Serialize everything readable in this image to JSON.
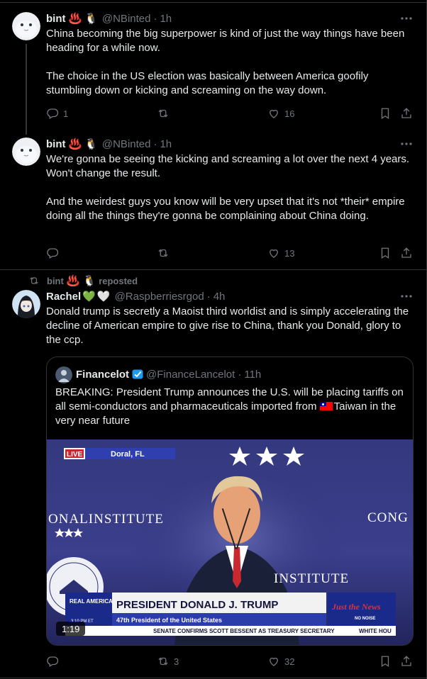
{
  "colors": {
    "background": "#000000",
    "text": "#e7e9ea",
    "muted": "#71767b",
    "border": "#2f3336",
    "verified": "#1d9bf0"
  },
  "posts": [
    {
      "name": "bint",
      "emojis": [
        "♨️",
        "🐧"
      ],
      "handle": "@NBinted",
      "dot": "·",
      "time": "1h",
      "text": "China becoming the big superpower is kind of just the way things have been heading for a while now.\n\nThe choice in the US election was basically between America goofily stumbling down or kicking and screaming on the way down.",
      "actions": {
        "reply": "1",
        "repost": "",
        "like": "16"
      }
    },
    {
      "name": "bint",
      "emojis": [
        "♨️",
        "🐧"
      ],
      "handle": "@NBinted",
      "dot": "·",
      "time": "1h",
      "text": "We're gonna be seeing the kicking and screaming a lot over the next 4 years. Won't change the result.\n\nAnd the weirdest guys you know will be very upset that it's not *their* empire doing all the things they're gonna be complaining about China doing.",
      "actions": {
        "reply": "",
        "repost": "",
        "like": "13"
      }
    },
    {
      "repost_by": "bint",
      "repost_emojis": [
        "♨️",
        "🐧"
      ],
      "repost_label": "reposted",
      "name": "Rachel",
      "emojis": [
        "💚",
        "🤍"
      ],
      "handle": "@Raspberriesrgod",
      "dot": "·",
      "time": "4h",
      "text": "Donald trump is secretly a Maoist third worldist and is simply accelerating the decline of American empire to give rise to China, thank you Donald, glory to the ccp.",
      "actions": {
        "reply": "",
        "repost": "3",
        "like": "32"
      },
      "quote": {
        "name": "Financelot",
        "handle": "@FinanceLancelot",
        "dot": "·",
        "time": "11h",
        "text_before_flag": "BREAKING: President Trump announces the U.S. will be placing tariffs on all semi-conductors and pharmaceuticals imported from ",
        "text_after_flag": "Taiwan in the very near future",
        "video": {
          "duration": "1:19",
          "live_badge": "LIVE",
          "location": "Doral, FL",
          "backdrop_left": "ONALINSTITUTE",
          "backdrop_right": "CONG",
          "backdrop_lower": "INSTITUTE",
          "network_logo": "REAL AMERICA'S VOICE",
          "network_time": "3:10 PM ET",
          "banner_title": "PRESIDENT DONALD J. TRUMP",
          "banner_subtitle": "47th President of the United States",
          "ticker": "SENATE CONFIRMS SCOTT BESSENT AS TREASURY SECRETARY",
          "ticker_right": "WHITE HOU",
          "show_logo": "Just the News",
          "show_tag": "NO NOISE"
        }
      }
    }
  ]
}
